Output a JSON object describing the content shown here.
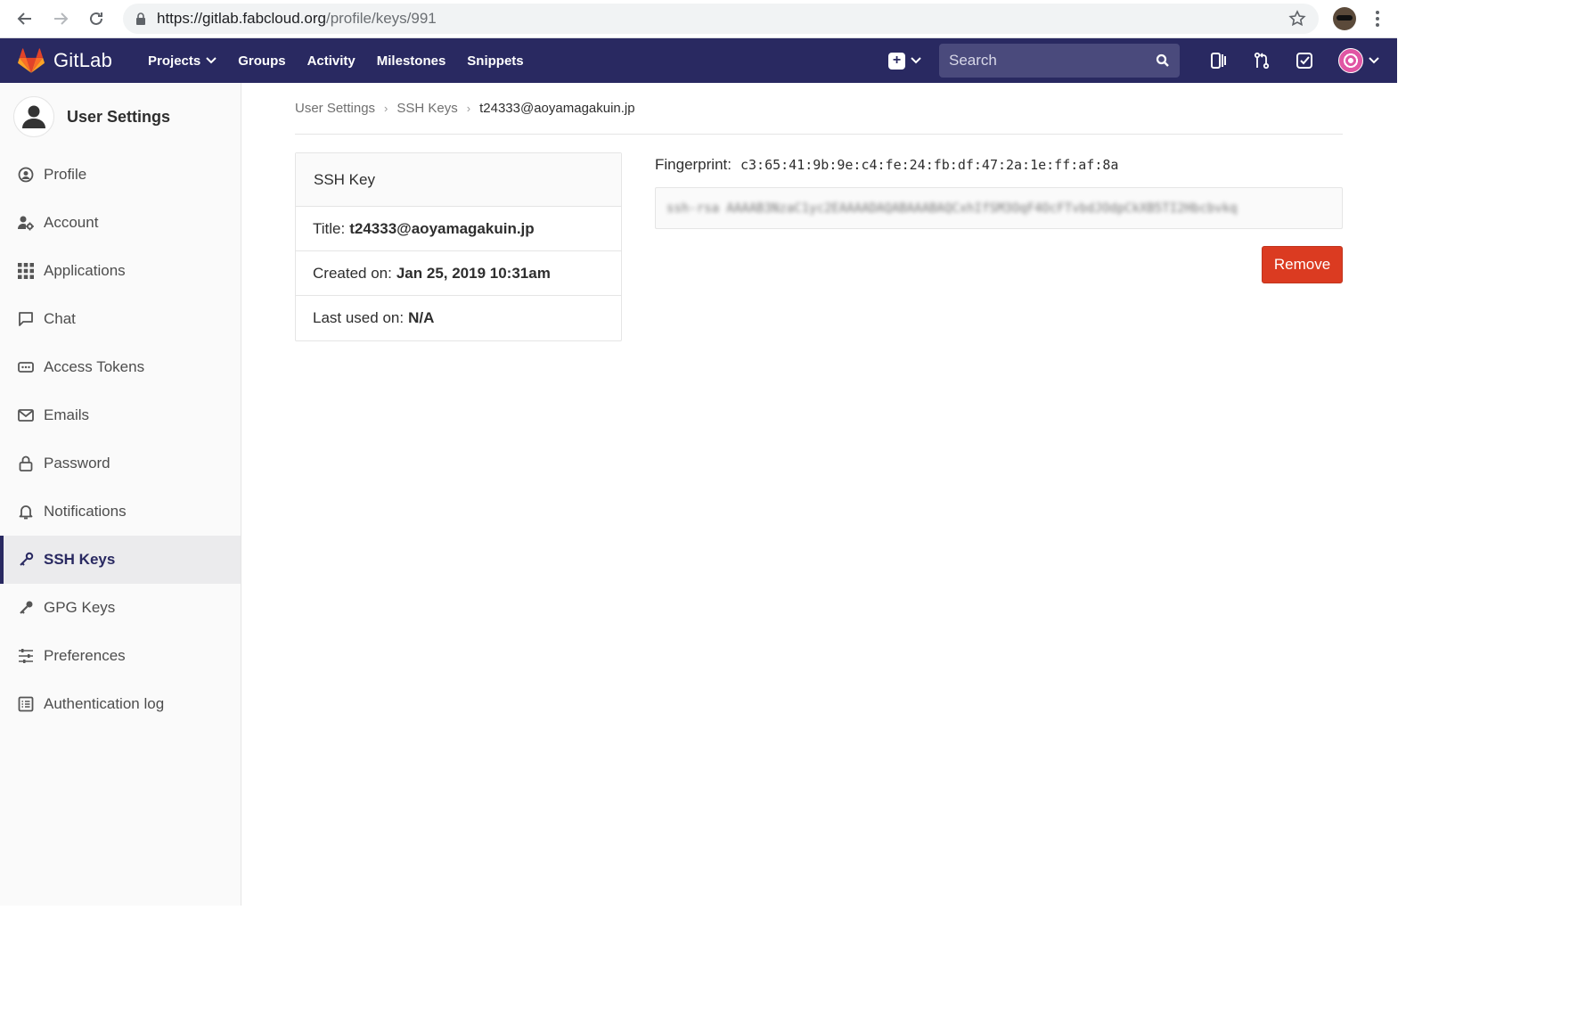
{
  "browser": {
    "url_host": "https://gitlab.fabcloud.org",
    "url_path": "/profile/keys/991"
  },
  "navbar": {
    "brand": "GitLab",
    "links": [
      "Projects",
      "Groups",
      "Activity",
      "Milestones",
      "Snippets"
    ],
    "search_placeholder": "Search"
  },
  "sidebar": {
    "title": "User Settings",
    "items": [
      {
        "label": "Profile",
        "icon": "profile-icon"
      },
      {
        "label": "Account",
        "icon": "account-icon"
      },
      {
        "label": "Applications",
        "icon": "applications-icon"
      },
      {
        "label": "Chat",
        "icon": "chat-icon"
      },
      {
        "label": "Access Tokens",
        "icon": "token-icon"
      },
      {
        "label": "Emails",
        "icon": "email-icon"
      },
      {
        "label": "Password",
        "icon": "lock-icon"
      },
      {
        "label": "Notifications",
        "icon": "bell-icon"
      },
      {
        "label": "SSH Keys",
        "icon": "key-icon",
        "active": true
      },
      {
        "label": "GPG Keys",
        "icon": "key-icon"
      },
      {
        "label": "Preferences",
        "icon": "preferences-icon"
      },
      {
        "label": "Authentication log",
        "icon": "log-icon"
      }
    ]
  },
  "breadcrumbs": [
    "User Settings",
    "SSH Keys",
    "t24333@aoyamagakuin.jp"
  ],
  "ssh_key": {
    "header": "SSH Key",
    "title_label": "Title:",
    "title_value": "t24333@aoyamagakuin.jp",
    "created_label": "Created on:",
    "created_value": "Jan 25, 2019 10:31am",
    "last_used_label": "Last used on:",
    "last_used_value": "N/A",
    "fingerprint_label": "Fingerprint:",
    "fingerprint_value": "c3:65:41:9b:9e:c4:fe:24:fb:df:47:2a:1e:ff:af:8a"
  },
  "actions": {
    "remove_label": "Remove"
  },
  "colors": {
    "navbar_bg": "#292961",
    "remove_bg": "#db3b21"
  }
}
